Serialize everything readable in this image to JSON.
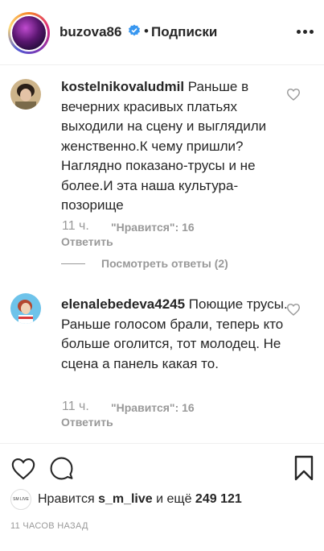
{
  "header": {
    "username": "buzova86",
    "separator": "•",
    "follow_status": "Подписки"
  },
  "comments": [
    {
      "username": "kostelnikovaludmil",
      "text": "Раньше в вечерних красивых платьях выходили на сцену и выглядили женственно.К чему пришли? Наглядно показано-трусы и не более.И эта наша культура-позорище",
      "time": "11 ч.",
      "likes": "\"Нравится\": 16",
      "reply": "Ответить",
      "view_replies": "Посмотреть ответы (2)"
    },
    {
      "username": "elenalebedeva4245",
      "text": "Поющие трусы. Раньше голосом брали, теперь кто больше оголится, тот молодец. Не сцена а панель какая то.",
      "time": "11 ч.",
      "likes": "\"Нравится\": 16",
      "reply": "Ответить"
    }
  ],
  "footer": {
    "liked_by_prefix": "Нравится",
    "liked_by_user": "s_m_live",
    "liked_by_and": "и ещё",
    "liked_by_count": "249 121",
    "mini_avatar_text": "SM LIVE",
    "time_ago": "11 ЧАСОВ НАЗАД"
  },
  "icons": {
    "verified": "verified-badge-icon",
    "more": "more-options-icon",
    "heart": "heart-icon",
    "comment": "comment-icon",
    "save": "bookmark-icon"
  },
  "colors": {
    "verified_blue": "#3897f0",
    "meta_gray": "#999999",
    "text": "#262626"
  }
}
